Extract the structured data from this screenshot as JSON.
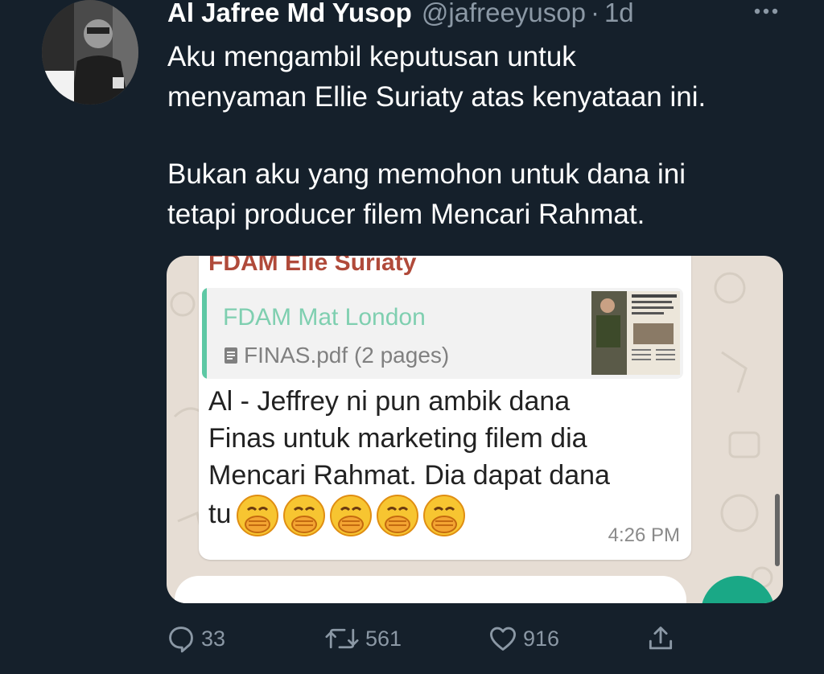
{
  "tweet": {
    "display_name": "Al Jafree Md Yusop",
    "handle": "@jafreeyusop",
    "separator": "·",
    "time": "1d",
    "text_lines": [
      "Aku mengambil keputusan untuk",
      "menyaman Ellie Suriaty atas kenyataan ini.",
      "Bukan aku yang memohon untuk dana ini",
      "tetapi producer filem Mencari Rahmat."
    ]
  },
  "media": {
    "sender": "FDAM Elie Suriaty",
    "quote_author": "FDAM Mat London",
    "quote_file": "FINAS.pdf (2 pages)",
    "message_lines": [
      "Al - Jeffrey ni pun ambik dana",
      "Finas untuk marketing filem dia",
      "Mencari Rahmat. Dia dapat dana",
      "tu"
    ],
    "emoji_name": "face-with-hand-over-mouth",
    "emoji_count": 5,
    "message_time": "4:26 PM",
    "colors": {
      "sender": "#b04a3a",
      "quote_bar": "#5dc8a4",
      "chat_background": "#e6ddd4",
      "fab": "#1aa886"
    }
  },
  "actions": {
    "reply_count": "33",
    "retweet_count": "561",
    "like_count": "916"
  },
  "icons": [
    "more-icon",
    "reply-icon",
    "retweet-icon",
    "like-icon",
    "share-icon",
    "document-icon"
  ],
  "colors": {
    "background": "#15202b",
    "text_primary": "#ffffff",
    "text_secondary": "#8b98a5"
  }
}
